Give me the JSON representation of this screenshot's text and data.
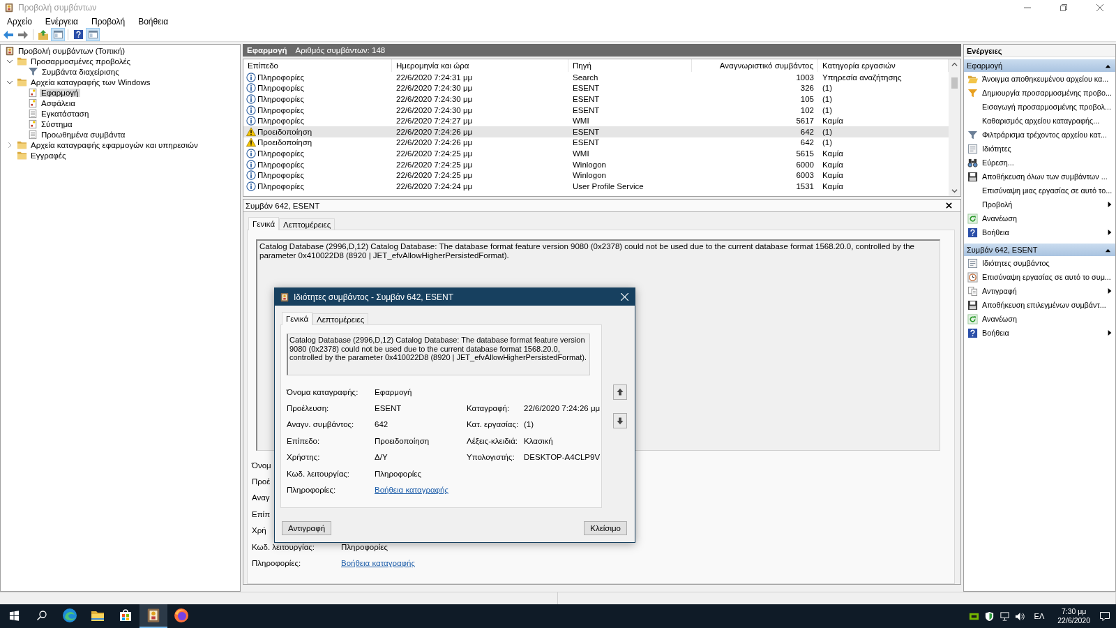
{
  "window": {
    "title": "Προβολή συμβάντων"
  },
  "menu": [
    "Αρχείο",
    "Ενέργεια",
    "Προβολή",
    "Βοήθεια"
  ],
  "toolbar": [
    {
      "kind": "back",
      "pressed": false
    },
    {
      "kind": "forward",
      "pressed": false
    },
    {
      "kind": "up",
      "pressed": false
    },
    {
      "kind": "tree-pane",
      "pressed": true
    },
    {
      "kind": "help",
      "pressed": false
    },
    {
      "kind": "action-pane",
      "pressed": true
    }
  ],
  "tree": [
    {
      "label": "Προβολή συμβάντων (Τοπική)",
      "kind": "viewer",
      "selected": false,
      "children": [
        {
          "label": "Προσαρμοσμένες προβολές",
          "kind": "folder",
          "selected": false,
          "expanded": true,
          "children": [
            {
              "label": "Συμβάντα διαχείρισης",
              "kind": "filter",
              "selected": false
            }
          ]
        },
        {
          "label": "Αρχεία καταγραφής των Windows",
          "kind": "folder",
          "selected": false,
          "expanded": true,
          "children": [
            {
              "label": "Εφαρμογή",
              "kind": "log",
              "selected": true
            },
            {
              "label": "Ασφάλεια",
              "kind": "log",
              "selected": false
            },
            {
              "label": "Εγκατάσταση",
              "kind": "plain-log",
              "selected": false
            },
            {
              "label": "Σύστημα",
              "kind": "log",
              "selected": false
            },
            {
              "label": "Προωθημένα συμβάντα",
              "kind": "plain-log",
              "selected": false
            }
          ]
        },
        {
          "label": "Αρχεία καταγραφής εφαρμογών και υπηρεσιών",
          "kind": "folder",
          "selected": false,
          "expanded": false
        },
        {
          "label": "Εγγραφές",
          "kind": "folder",
          "selected": false
        }
      ]
    }
  ],
  "center": {
    "title": "Εφαρμογή",
    "count": "Αριθμός συμβάντων: 148"
  },
  "table": {
    "columns": [
      "Επίπεδο",
      "Ημερομηνία και ώρα",
      "Πηγή",
      "Αναγνωριστικό συμβάντος",
      "Κατηγορία εργασιών"
    ],
    "rows": [
      {
        "kind": "info",
        "severity": "Πληροφορίες",
        "datetime": "22/6/2020 7:24:31 μμ",
        "source": "Search",
        "event_id": "1003",
        "task_category": "Υπηρεσία αναζήτησης",
        "selected": false
      },
      {
        "kind": "info",
        "severity": "Πληροφορίες",
        "datetime": "22/6/2020 7:24:30 μμ",
        "source": "ESENT",
        "event_id": "326",
        "task_category": "(1)",
        "selected": false
      },
      {
        "kind": "info",
        "severity": "Πληροφορίες",
        "datetime": "22/6/2020 7:24:30 μμ",
        "source": "ESENT",
        "event_id": "105",
        "task_category": "(1)",
        "selected": false
      },
      {
        "kind": "info",
        "severity": "Πληροφορίες",
        "datetime": "22/6/2020 7:24:30 μμ",
        "source": "ESENT",
        "event_id": "102",
        "task_category": "(1)",
        "selected": false
      },
      {
        "kind": "info",
        "severity": "Πληροφορίες",
        "datetime": "22/6/2020 7:24:27 μμ",
        "source": "WMI",
        "event_id": "5617",
        "task_category": "Καμία",
        "selected": false
      },
      {
        "kind": "warning",
        "severity": "Προειδοποίηση",
        "datetime": "22/6/2020 7:24:26 μμ",
        "source": "ESENT",
        "event_id": "642",
        "task_category": "(1)",
        "selected": true
      },
      {
        "kind": "warning",
        "severity": "Προειδοποίηση",
        "datetime": "22/6/2020 7:24:26 μμ",
        "source": "ESENT",
        "event_id": "642",
        "task_category": "(1)",
        "selected": false
      },
      {
        "kind": "info",
        "severity": "Πληροφορίες",
        "datetime": "22/6/2020 7:24:25 μμ",
        "source": "WMI",
        "event_id": "5615",
        "task_category": "Καμία",
        "selected": false
      },
      {
        "kind": "info",
        "severity": "Πληροφορίες",
        "datetime": "22/6/2020 7:24:25 μμ",
        "source": "Winlogon",
        "event_id": "6000",
        "task_category": "Καμία",
        "selected": false
      },
      {
        "kind": "info",
        "severity": "Πληροφορίες",
        "datetime": "22/6/2020 7:24:25 μμ",
        "source": "Winlogon",
        "event_id": "6003",
        "task_category": "Καμία",
        "selected": false
      },
      {
        "kind": "info",
        "severity": "Πληροφορίες",
        "datetime": "22/6/2020 7:24:24 μμ",
        "source": "User Profile Service",
        "event_id": "1531",
        "task_category": "Καμία",
        "selected": false
      }
    ]
  },
  "details": {
    "title": "Συμβάν 642, ESENT",
    "tabs": [
      {
        "label": "Γενικά",
        "selected": true
      },
      {
        "label": "Λεπτομέρειες",
        "selected": false
      }
    ],
    "message": "Catalog Database (2996,D,12) Catalog Database: The database format feature version 9080 (0x2378) could not be used due to the current database format 1568.20.0, controlled by the parameter 0x410022D8 (8920 | JET_efvAllowHigherPersistedFormat).",
    "fields": [
      {
        "label": "Όνομ"
      },
      {
        "label": "Προέ"
      },
      {
        "label": "Αναγ"
      },
      {
        "label": "Επίπ"
      },
      {
        "label": "Χρή"
      },
      {
        "label": "Κωδ. λειτουργίας:",
        "value": "Πληροφορίες",
        "kind": "text"
      },
      {
        "label": "Πληροφορίες:",
        "value": "Βοήθεια καταγραφής",
        "kind": "link"
      }
    ]
  },
  "dialog": {
    "title": "Ιδιότητες συμβάντος - Συμβάν 642, ESENT",
    "tabs": [
      {
        "label": "Γενικά",
        "selected": true
      },
      {
        "label": "Λεπτομέρειες",
        "selected": false
      }
    ],
    "message": "Catalog Database (2996,D,12) Catalog Database: The database format feature version 9080 (0x2378) could not be used due to the current database format 1568.20.0, controlled by the parameter 0x410022D8 (8920 | JET_efvAllowHigherPersistedFormat).",
    "fields": [
      {
        "label": "Όνομα καταγραφής:",
        "value": "Εφαρμογή",
        "kind": "text"
      },
      {
        "label": "Προέλευση:",
        "value": "ESENT",
        "kind": "text"
      },
      {
        "label": "Αναγν. συμβάντος:",
        "value": "642",
        "kind": "text"
      },
      {
        "label": "Επίπεδο:",
        "value": "Προειδοποίηση",
        "kind": "text"
      },
      {
        "label": "Χρήστης:",
        "value": "Δ/Υ",
        "kind": "text"
      },
      {
        "label": "Κωδ. λειτουργίας:",
        "value": "Πληροφορίες",
        "kind": "text"
      },
      {
        "label": "Πληροφορίες:",
        "value": "Βοήθεια καταγραφής",
        "kind": "link"
      }
    ],
    "side_fields": [
      {
        "label": "Καταγραφή:",
        "value": "22/6/2020 7:24:26 μμ"
      },
      {
        "label": "Κατ. εργασίας:",
        "value": "(1)"
      },
      {
        "label": "Λέξεις-κλειδιά:",
        "value": "Κλασική"
      },
      {
        "label": "Υπολογιστής:",
        "value": "DESKTOP-A4CLP9V"
      }
    ],
    "buttons": [
      "Αντιγραφή",
      "Κλείσιμο"
    ]
  },
  "actions": {
    "title": "Ενέργειες",
    "sections": [
      {
        "title": "Εφαρμογή",
        "expanded": true,
        "items": [
          {
            "label": "Άνοιγμα αποθηκευμένου αρχείου κα...",
            "kind": "open",
            "submenu": false
          },
          {
            "label": "Δημιουργία προσαρμοσμένης προβο...",
            "kind": "create-view",
            "submenu": false
          },
          {
            "label": "Εισαγωγή προσαρμοσμένης προβολ...",
            "kind": "none",
            "submenu": false
          },
          {
            "label": "Καθαρισμός αρχείου καταγραφής...",
            "kind": "none",
            "submenu": false
          },
          {
            "label": "Φιλτράρισμα τρέχοντος αρχείου κατ...",
            "kind": "filter",
            "submenu": false
          },
          {
            "label": "Ιδιότητες",
            "kind": "properties",
            "submenu": false
          },
          {
            "label": "Εύρεση...",
            "kind": "find",
            "submenu": false
          },
          {
            "label": "Αποθήκευση όλων των συμβάντων ...",
            "kind": "save",
            "submenu": false
          },
          {
            "label": "Επισύναψη μιας εργασίας σε αυτό το...",
            "kind": "none",
            "submenu": false
          },
          {
            "label": "Προβολή",
            "kind": "none",
            "submenu": true
          },
          {
            "label": "Ανανέωση",
            "kind": "refresh",
            "submenu": false
          },
          {
            "label": "Βοήθεια",
            "kind": "help",
            "submenu": true
          }
        ]
      },
      {
        "title": "Συμβάν 642, ESENT",
        "expanded": true,
        "items": [
          {
            "label": "Ιδιότητες συμβάντος",
            "kind": "properties",
            "submenu": false
          },
          {
            "label": "Επισύναψη εργασίας σε αυτό το συμ...",
            "kind": "attach",
            "submenu": false
          },
          {
            "label": "Αντιγραφή",
            "kind": "copy",
            "submenu": true
          },
          {
            "label": "Αποθήκευση επιλεγμένων συμβάντ...",
            "kind": "save",
            "submenu": false
          },
          {
            "label": "Ανανέωση",
            "kind": "refresh",
            "submenu": false
          },
          {
            "label": "Βοήθεια",
            "kind": "help",
            "submenu": true
          }
        ]
      }
    ]
  },
  "taskbar": {
    "apps": [
      {
        "kind": "edge",
        "active": false
      },
      {
        "kind": "explorer",
        "active": false
      },
      {
        "kind": "store",
        "active": false
      },
      {
        "kind": "event-viewer",
        "active": true
      },
      {
        "kind": "firefox",
        "active": false
      }
    ],
    "language": "ΕΛ",
    "time": "7:30 μμ",
    "date": "22/6/2020"
  }
}
